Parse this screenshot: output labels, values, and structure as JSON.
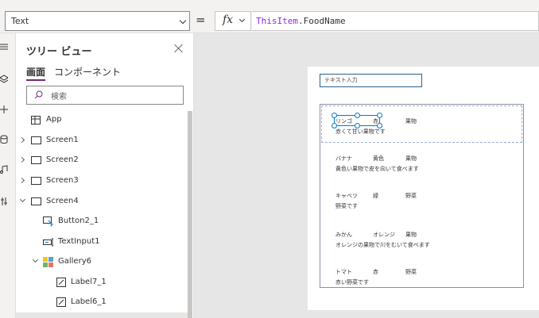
{
  "formula_bar": {
    "property": "Text",
    "equals": "=",
    "fx": "fx",
    "formula_object": "ThisItem",
    "formula_rest": ".FoodName"
  },
  "tree_view": {
    "title": "ツリー ビュー",
    "tabs": [
      "画面",
      "コンポーネント"
    ],
    "search_placeholder": "検索",
    "nodes": [
      {
        "label": "App"
      },
      {
        "label": "Screen1"
      },
      {
        "label": "Screen2"
      },
      {
        "label": "Screen3"
      },
      {
        "label": "Screen4"
      },
      {
        "label": "Button2_1"
      },
      {
        "label": "TextInput1"
      },
      {
        "label": "Gallery6"
      },
      {
        "label": "Label7_1"
      },
      {
        "label": "Label6_1"
      }
    ]
  },
  "canvas": {
    "text_input_placeholder": "テキスト入力",
    "gallery_items": [
      {
        "name": "リンゴ",
        "color": "赤",
        "category": "果物",
        "description": "赤くて甘い果物です"
      },
      {
        "name": "バナナ",
        "color": "黄色",
        "category": "果物",
        "description": "黄色い果物で皮を向いて食べます"
      },
      {
        "name": "キャベツ",
        "color": "緑",
        "category": "野菜",
        "description": "野菜です"
      },
      {
        "name": "みかん",
        "color": "オレンジ",
        "category": "果物",
        "description": "オレンジの果物で川をむいて食べます"
      },
      {
        "name": "トマト",
        "color": "赤",
        "category": "野菜",
        "description": "赤い野菜です"
      }
    ]
  },
  "colors": {
    "accent": "#742774",
    "selection": "#0078d4",
    "formula_keyword": "#8a2be2"
  }
}
